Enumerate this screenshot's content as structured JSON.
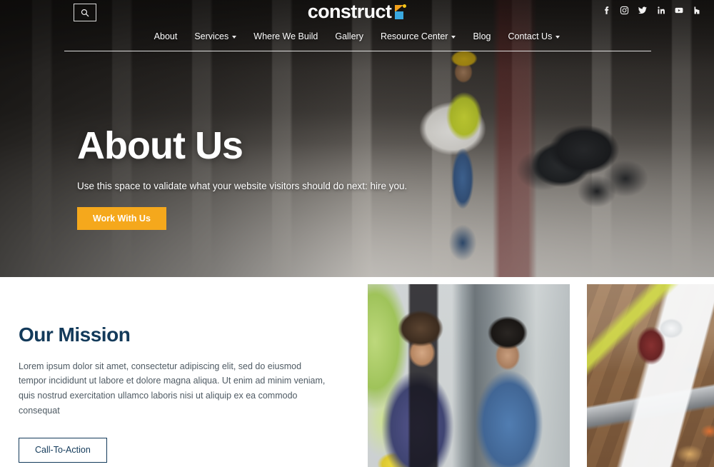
{
  "header": {
    "search_icon": "search-icon",
    "brand": {
      "name": "construct",
      "mark": "logo-mark"
    },
    "socials": [
      {
        "name": "facebook-icon",
        "label": "Facebook"
      },
      {
        "name": "instagram-icon",
        "label": "Instagram"
      },
      {
        "name": "twitter-icon",
        "label": "Twitter"
      },
      {
        "name": "linkedin-icon",
        "label": "LinkedIn"
      },
      {
        "name": "youtube-icon",
        "label": "YouTube"
      },
      {
        "name": "houzz-icon",
        "label": "Houzz"
      }
    ],
    "nav": [
      {
        "label": "About",
        "dropdown": false
      },
      {
        "label": "Services",
        "dropdown": true
      },
      {
        "label": "Where We Build",
        "dropdown": false
      },
      {
        "label": "Gallery",
        "dropdown": false
      },
      {
        "label": "Resource Center",
        "dropdown": true
      },
      {
        "label": "Blog",
        "dropdown": false
      },
      {
        "label": "Contact Us",
        "dropdown": true
      }
    ]
  },
  "hero": {
    "title": "About Us",
    "subtitle": "Use this space to validate what your website visitors should do next: hire you.",
    "cta_label": "Work With Us",
    "image_alt": "construction worker in yellow hard hat reading blueprints in a concrete corridor"
  },
  "mission": {
    "title": "Our Mission",
    "body": "Lorem ipsum dolor sit amet, consectetur adipiscing elit, sed do eiusmod tempor incididunt ut labore et dolore magna aliqua. Ut enim ad minim veniam, quis nostrud exercitation ullamco laboris nisi ut aliquip ex ea commodo consequat",
    "cta_label": "Call-To-Action",
    "photos": [
      {
        "name": "photo-team",
        "alt": "two men in blue shirts reviewing work with a yellow hard hat"
      },
      {
        "name": "photo-blueprints",
        "alt": "overhead view of worker with blueprints, laptop and gloves on a wooden table"
      }
    ]
  },
  "colors": {
    "accent_yellow": "#f5a81c",
    "brand_navy": "#133a5a",
    "body_text": "#4e5a63",
    "logo_orange": "#f2a01c",
    "logo_blue": "#3aa9e0",
    "page_background": "#ffffff"
  }
}
